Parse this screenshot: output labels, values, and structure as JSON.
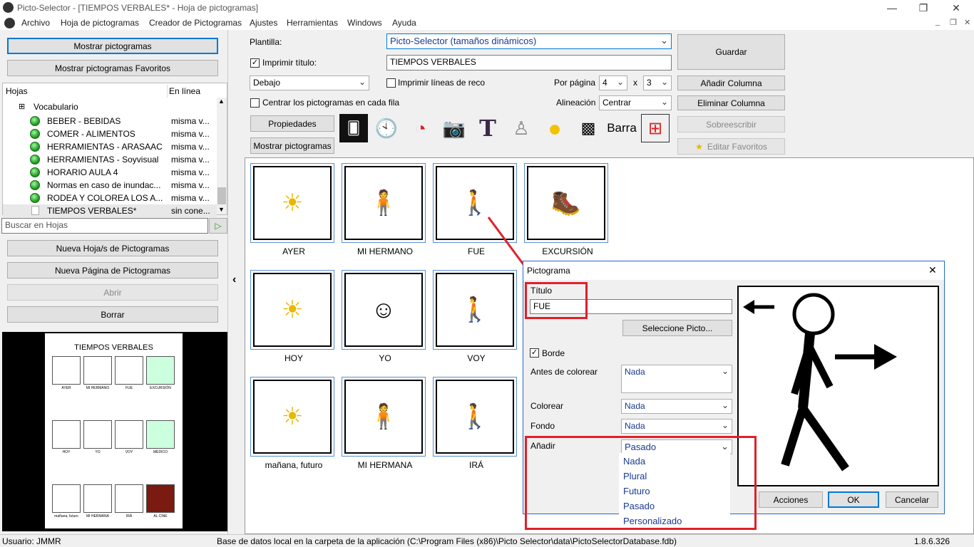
{
  "window": {
    "title": "Picto-Selector - [TIEMPOS VERBALES* - Hoja de pictogramas]",
    "min": "—",
    "restore": "❐",
    "close": "✕"
  },
  "menu": [
    "Archivo",
    "Hoja de pictogramas",
    "Creador de Pictogramas",
    "Ajustes",
    "Herramientas",
    "Windows",
    "Ayuda"
  ],
  "left": {
    "show_picto": "Mostrar pictogramas",
    "show_fav": "Mostrar pictogramas Favoritos",
    "col_sheets": "Hojas",
    "col_online": "En línea",
    "root": "Vocabulario",
    "items": [
      {
        "name": "BEBER - BEBIDAS",
        "status": "misma v..."
      },
      {
        "name": "COMER - ALIMENTOS",
        "status": "misma v..."
      },
      {
        "name": "HERRAMIENTAS - ARASAAC",
        "status": "misma v..."
      },
      {
        "name": "HERRAMIENTAS - Soyvisual",
        "status": "misma v..."
      },
      {
        "name": "HORARIO AULA 4",
        "status": "misma v..."
      },
      {
        "name": "Normas en caso de inundac...",
        "status": "misma v..."
      },
      {
        "name": "RODEA Y COLOREA LOS A...",
        "status": "misma v..."
      },
      {
        "name": "TIEMPOS VERBALES*",
        "status": "sin cone..."
      }
    ],
    "search_placeholder": "Buscar en Hojas",
    "new_sheet": "Nueva Hoja/s de Pictogramas",
    "new_page": "Nueva Página de Pictogramas",
    "open": "Abrir",
    "delete": "Borrar",
    "preview_title": "TIEMPOS VERBALES",
    "preview_labels": [
      "AYER",
      "MI HERMANO",
      "FUE",
      "EXCURSIÓN",
      "HOY",
      "YO",
      "VOY",
      "MÉDICO",
      "mañana, futuro",
      "MI HERMANA",
      "IRÁ",
      "AL CINE"
    ]
  },
  "toolbar": {
    "template_label": "Plantilla:",
    "template_value": "Picto-Selector (tamaños dinámicos)",
    "print_title_label": "Imprimir título:",
    "title_value": "TIEMPOS VERBALES",
    "position": "Debajo",
    "print_lines": "Imprimir líneas de reco",
    "per_page": "Por página",
    "per_page_a": "4",
    "x": "x",
    "per_page_b": "3",
    "center": "Centrar los pictogramas en cada fila",
    "align_label": "Alineación",
    "align_value": "Centrar",
    "props": "Propiedades",
    "show": "Mostrar pictogramas",
    "barra": "Barra",
    "save": "Guardar",
    "add_col": "Añadir Columna",
    "del_col": "Eliminar Columna",
    "overwrite": "Sobreescribir",
    "edit_fav": "Editar Favoritos"
  },
  "grid": {
    "labels": [
      "AYER",
      "MI HERMANO",
      "FUE",
      "EXCURSIÓN",
      "HOY",
      "YO",
      "VOY",
      "mañana, futuro",
      "MI HERMANA",
      "IRÁ"
    ]
  },
  "dialog": {
    "title": "Pictograma",
    "titulo_label": "Título",
    "titulo_value": "FUE",
    "select": "Seleccione Picto...",
    "border": "Borde",
    "before_color": "Antes de colorear",
    "before_value": "Nada",
    "color": "Colorear",
    "color_value": "Nada",
    "bg": "Fondo",
    "bg_value": "Nada",
    "add": "Añadir",
    "add_value": "Pasado",
    "options": [
      "Nada",
      "Plural",
      "Futuro",
      "Pasado",
      "Personalizado"
    ],
    "actions": "Acciones",
    "ok": "OK",
    "cancel": "Cancelar"
  },
  "status": {
    "user": "Usuario: JMMR",
    "db": "Base de datos local en la carpeta de la aplicación (C:\\Program Files (x86)\\Picto Selector\\data\\PictoSelectorDatabase.fdb)",
    "version": "1.8.6.326"
  }
}
